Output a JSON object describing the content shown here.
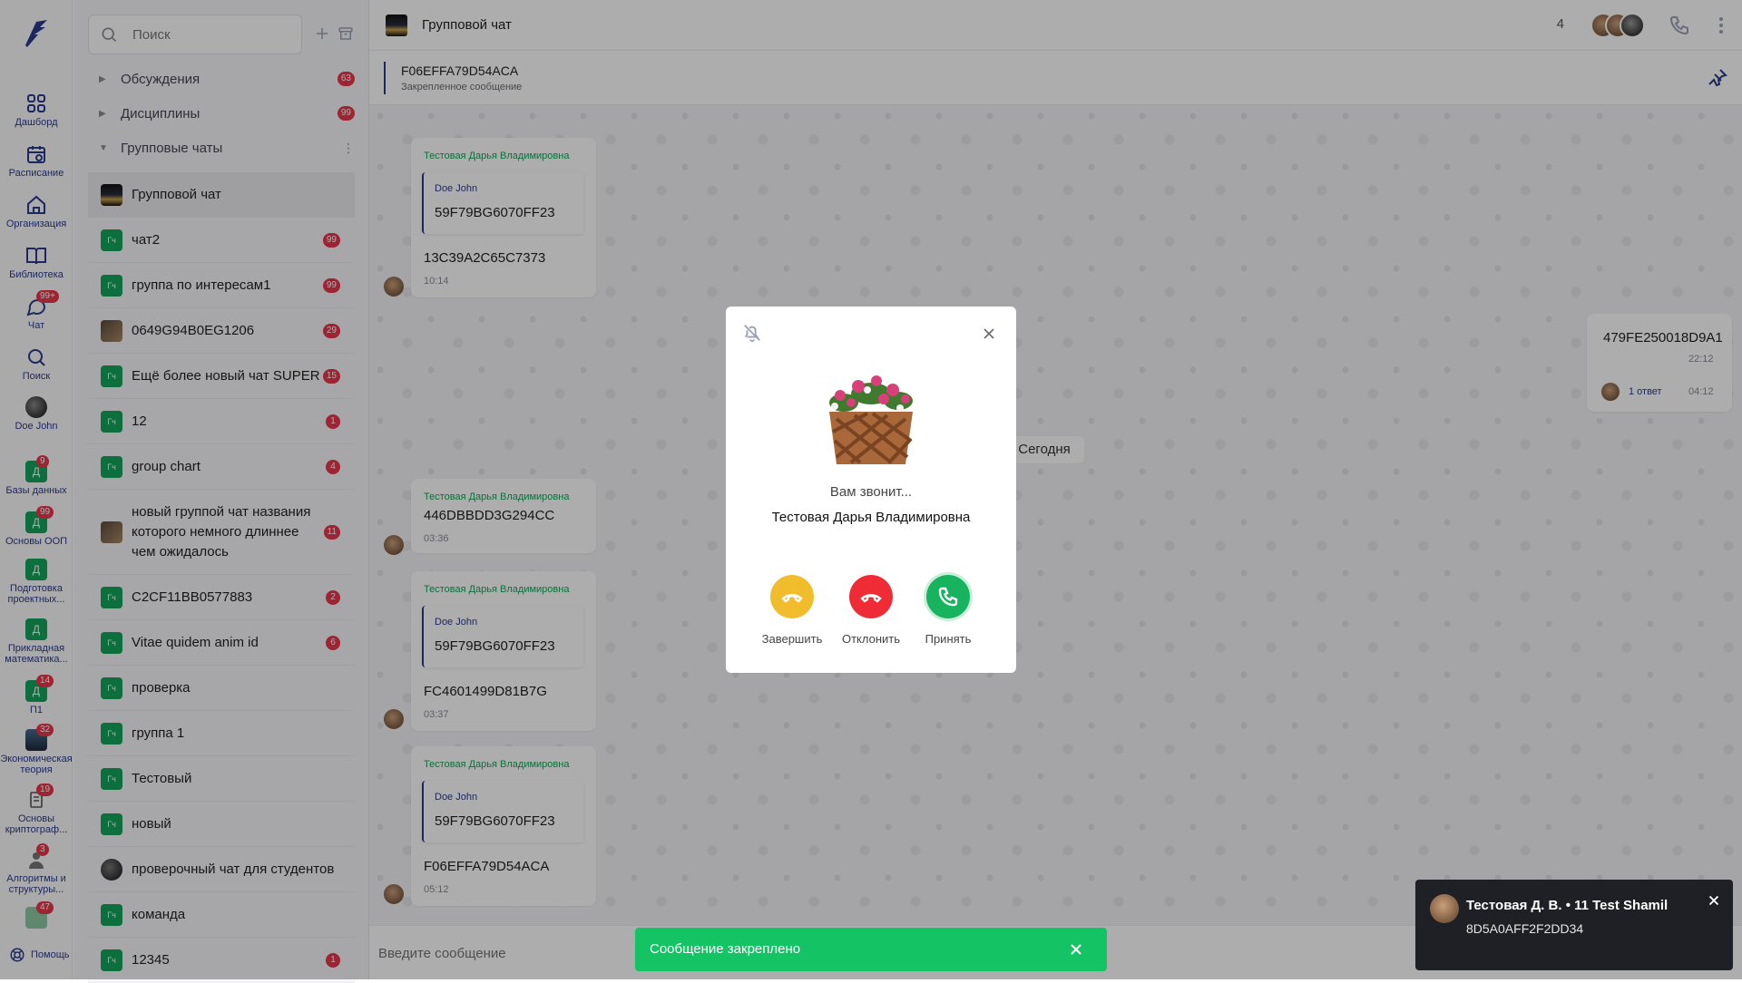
{
  "rail": {
    "items": [
      {
        "label": "Дашборд",
        "icon": "dashboard-icon"
      },
      {
        "label": "Расписание",
        "icon": "calendar-icon"
      },
      {
        "label": "Организация",
        "icon": "home-icon"
      },
      {
        "label": "Библиотека",
        "icon": "book-icon"
      },
      {
        "label": "Чат",
        "icon": "chat-icon",
        "badge": "99+"
      },
      {
        "label": "Поиск",
        "icon": "search-icon"
      },
      {
        "label": "Doe John",
        "icon": "avatar"
      },
      {
        "label": "Базы данных",
        "tile": "Д",
        "badge": "9"
      },
      {
        "label": "Основы ООП",
        "tile": "Д",
        "badge": "99"
      },
      {
        "label": "Подготовка проектных...",
        "tile": "Д"
      },
      {
        "label": "Прикладная математика...",
        "tile": "Д"
      },
      {
        "label": "П1",
        "tile": "Д",
        "badge": "14"
      },
      {
        "label": "Экономическая теория",
        "badge": "32"
      },
      {
        "label": "Основы криптограф...",
        "badge": "19"
      },
      {
        "label": "Алгоритмы и структуры...",
        "badge": "3"
      }
    ],
    "extra_badge": "47",
    "help": "Помощь"
  },
  "panel": {
    "search_placeholder": "Поиск",
    "sections": [
      {
        "label": "Обсуждения",
        "count": "63"
      },
      {
        "label": "Дисциплины",
        "count": "99"
      },
      {
        "label": "Групповые чаты",
        "count": ""
      }
    ],
    "chats": [
      {
        "name": "Групповой чат",
        "badge": "",
        "avatar": "image-dark",
        "active": true
      },
      {
        "name": "чат2",
        "badge": "99",
        "avatar": "Гч"
      },
      {
        "name": "группа по интересам1",
        "badge": "99",
        "avatar": "Гч"
      },
      {
        "name": "0649G94B0EG1206",
        "badge": "29",
        "avatar": "image-person"
      },
      {
        "name": "Ещё более новый чат SUPER",
        "badge": "15",
        "avatar": "Гч"
      },
      {
        "name": "12",
        "badge": "1",
        "avatar": "Гч"
      },
      {
        "name": "group chart",
        "badge": "4",
        "avatar": "Гч"
      },
      {
        "name": "новый группой чат названия которого немного длиннее чем ожидалось",
        "badge": "11",
        "avatar": "image-person"
      },
      {
        "name": "C2CF11BB0577883",
        "badge": "2",
        "avatar": "Гч"
      },
      {
        "name": "Vitae quidem anim id",
        "badge": "6",
        "avatar": "Гч"
      },
      {
        "name": "проверка",
        "badge": "",
        "avatar": "Гч"
      },
      {
        "name": "группа 1",
        "badge": "",
        "avatar": "Гч"
      },
      {
        "name": "Тестовый",
        "badge": "",
        "avatar": "Гч"
      },
      {
        "name": "новый",
        "badge": "",
        "avatar": "Гч"
      },
      {
        "name": "проверочный чат для студентов",
        "badge": "",
        "avatar": "image-round"
      },
      {
        "name": "команда",
        "badge": "",
        "avatar": "Гч"
      },
      {
        "name": "12345",
        "badge": "1",
        "avatar": "Гч"
      }
    ]
  },
  "chat": {
    "title": "Групповой чат",
    "member_count": "4",
    "pinned": {
      "text": "F06EFFA79D54ACA",
      "caption": "Закрепленное сообщение"
    },
    "date_divider": "Сегодня",
    "messages": [
      {
        "author": "Тестовая Дарья Владимировна",
        "quote_author": "Doe John",
        "quote_text": "59F79BG6070FF23",
        "text": "13C39A2C65C7373",
        "time": "10:14"
      },
      {
        "author": "Тестовая Дарья Владимировна",
        "text": "446DBBDD3G294CC",
        "time": "03:36"
      },
      {
        "author": "Тестовая Дарья Владимировна",
        "quote_author": "Doe John",
        "quote_text": "59F79BG6070FF23",
        "text": "FC4601499D81B7G",
        "time": "03:37"
      },
      {
        "author": "Тестовая Дарья Владимировна",
        "quote_author": "Doe John",
        "quote_text": "59F79BG6070FF23",
        "text": "F06EFFA79D54ACA",
        "time": "05:12"
      }
    ],
    "own_message": {
      "text": "479FE250018D9A1",
      "time": "22:12",
      "replies": "1 ответ",
      "reply_time": "04:12"
    },
    "composer_placeholder": "Введите сообщение"
  },
  "call_modal": {
    "calling": "Вам звонит...",
    "caller": "Тестовая Дарья Владимировна",
    "buttons": [
      {
        "label": "Завершить",
        "color": "#f2bd2c"
      },
      {
        "label": "Отклонить",
        "color": "#ef2b35"
      },
      {
        "label": "Принять",
        "color": "#17b35f"
      }
    ]
  },
  "toast": {
    "text": "Сообщение закреплено",
    "color": "#14c464"
  },
  "notification": {
    "title": "Тестовая Д. В. • 11 Test Shamil",
    "body": "8D5A0AFF2F2DD34"
  }
}
